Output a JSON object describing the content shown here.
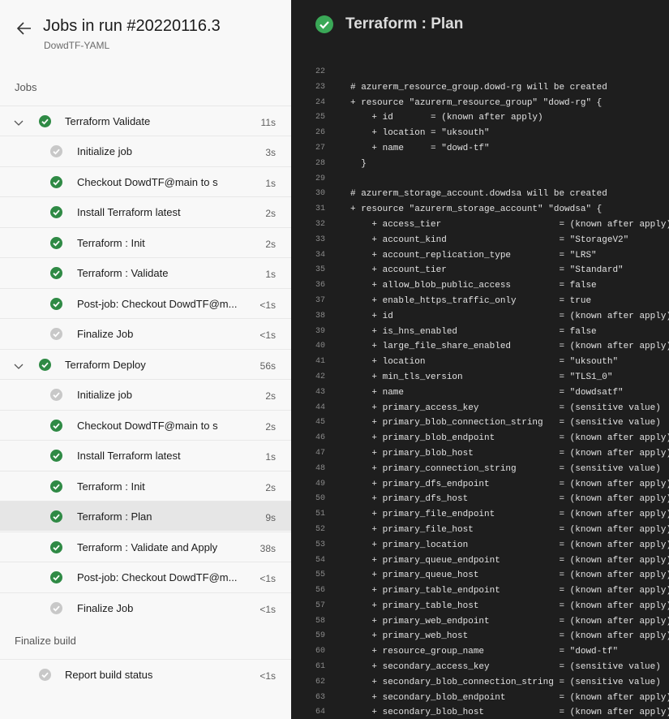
{
  "header": {
    "title": "Jobs in run #20220116.3",
    "subtitle": "DowdTF-YAML"
  },
  "sections": {
    "jobs": "Jobs",
    "finalize": "Finalize build"
  },
  "rows": [
    {
      "kind": "job",
      "status": "succeeded",
      "label": "Terraform Validate",
      "duration": "11s"
    },
    {
      "kind": "step",
      "status": "skipped",
      "label": "Initialize job",
      "duration": "3s"
    },
    {
      "kind": "step",
      "status": "succeeded",
      "label": "Checkout DowdTF@main to s",
      "duration": "1s"
    },
    {
      "kind": "step",
      "status": "succeeded",
      "label": "Install Terraform latest",
      "duration": "2s"
    },
    {
      "kind": "step",
      "status": "succeeded",
      "label": "Terraform : Init",
      "duration": "2s"
    },
    {
      "kind": "step",
      "status": "succeeded",
      "label": "Terraform : Validate",
      "duration": "1s"
    },
    {
      "kind": "step",
      "status": "succeeded",
      "label": "Post-job: Checkout DowdTF@m...",
      "duration": "<1s"
    },
    {
      "kind": "step",
      "status": "skipped",
      "label": "Finalize Job",
      "duration": "<1s"
    },
    {
      "kind": "job",
      "status": "succeeded",
      "label": "Terraform Deploy",
      "duration": "56s"
    },
    {
      "kind": "step",
      "status": "skipped",
      "label": "Initialize job",
      "duration": "2s"
    },
    {
      "kind": "step",
      "status": "succeeded",
      "label": "Checkout DowdTF@main to s",
      "duration": "2s"
    },
    {
      "kind": "step",
      "status": "succeeded",
      "label": "Install Terraform latest",
      "duration": "1s"
    },
    {
      "kind": "step",
      "status": "succeeded",
      "label": "Terraform : Init",
      "duration": "2s"
    },
    {
      "kind": "step",
      "status": "succeeded",
      "label": "Terraform : Plan",
      "duration": "9s",
      "selected": true
    },
    {
      "kind": "step",
      "status": "succeeded",
      "label": "Terraform : Validate and Apply",
      "duration": "38s"
    },
    {
      "kind": "step",
      "status": "succeeded",
      "label": "Post-job: Checkout DowdTF@m...",
      "duration": "<1s"
    },
    {
      "kind": "step",
      "status": "skipped",
      "label": "Finalize Job",
      "duration": "<1s"
    },
    {
      "kind": "final",
      "status": "skipped",
      "label": "Report build status",
      "duration": "<1s"
    }
  ],
  "job_panel": {
    "title": "Terraform : Plan",
    "status": "succeeded"
  },
  "colors": {
    "succeeded": "#2f8a45",
    "skipped": "#c8c8c8",
    "log_bg": "#1e1e1e"
  },
  "log": [
    {
      "n": "22",
      "t": ""
    },
    {
      "n": "23",
      "t": "# azurerm_resource_group.dowd-rg will be created"
    },
    {
      "n": "24",
      "t": "+ resource \"azurerm_resource_group\" \"dowd-rg\" {"
    },
    {
      "n": "25",
      "t": "    + id       = (known after apply)"
    },
    {
      "n": "26",
      "t": "    + location = \"uksouth\""
    },
    {
      "n": "27",
      "t": "    + name     = \"dowd-tf\""
    },
    {
      "n": "28",
      "t": "  }"
    },
    {
      "n": "29",
      "t": ""
    },
    {
      "n": "30",
      "t": "# azurerm_storage_account.dowdsa will be created"
    },
    {
      "n": "31",
      "t": "+ resource \"azurerm_storage_account\" \"dowdsa\" {"
    },
    {
      "n": "32",
      "t": "    + access_tier                      = (known after apply)"
    },
    {
      "n": "33",
      "t": "    + account_kind                     = \"StorageV2\""
    },
    {
      "n": "34",
      "t": "    + account_replication_type         = \"LRS\""
    },
    {
      "n": "35",
      "t": "    + account_tier                     = \"Standard\""
    },
    {
      "n": "36",
      "t": "    + allow_blob_public_access         = false"
    },
    {
      "n": "37",
      "t": "    + enable_https_traffic_only        = true"
    },
    {
      "n": "38",
      "t": "    + id                               = (known after apply)"
    },
    {
      "n": "39",
      "t": "    + is_hns_enabled                   = false"
    },
    {
      "n": "40",
      "t": "    + large_file_share_enabled         = (known after apply)"
    },
    {
      "n": "41",
      "t": "    + location                         = \"uksouth\""
    },
    {
      "n": "42",
      "t": "    + min_tls_version                  = \"TLS1_0\""
    },
    {
      "n": "43",
      "t": "    + name                             = \"dowdsatf\""
    },
    {
      "n": "44",
      "t": "    + primary_access_key               = (sensitive value)"
    },
    {
      "n": "45",
      "t": "    + primary_blob_connection_string   = (sensitive value)"
    },
    {
      "n": "46",
      "t": "    + primary_blob_endpoint            = (known after apply)"
    },
    {
      "n": "47",
      "t": "    + primary_blob_host                = (known after apply)"
    },
    {
      "n": "48",
      "t": "    + primary_connection_string        = (sensitive value)"
    },
    {
      "n": "49",
      "t": "    + primary_dfs_endpoint             = (known after apply)"
    },
    {
      "n": "50",
      "t": "    + primary_dfs_host                 = (known after apply)"
    },
    {
      "n": "51",
      "t": "    + primary_file_endpoint            = (known after apply)"
    },
    {
      "n": "52",
      "t": "    + primary_file_host                = (known after apply)"
    },
    {
      "n": "53",
      "t": "    + primary_location                 = (known after apply)"
    },
    {
      "n": "54",
      "t": "    + primary_queue_endpoint           = (known after apply)"
    },
    {
      "n": "55",
      "t": "    + primary_queue_host               = (known after apply)"
    },
    {
      "n": "56",
      "t": "    + primary_table_endpoint           = (known after apply)"
    },
    {
      "n": "57",
      "t": "    + primary_table_host               = (known after apply)"
    },
    {
      "n": "58",
      "t": "    + primary_web_endpoint             = (known after apply)"
    },
    {
      "n": "59",
      "t": "    + primary_web_host                 = (known after apply)"
    },
    {
      "n": "60",
      "t": "    + resource_group_name              = \"dowd-tf\""
    },
    {
      "n": "61",
      "t": "    + secondary_access_key             = (sensitive value)"
    },
    {
      "n": "62",
      "t": "    + secondary_blob_connection_string = (sensitive value)"
    },
    {
      "n": "63",
      "t": "    + secondary_blob_endpoint          = (known after apply)"
    },
    {
      "n": "64",
      "t": "    + secondary_blob_host              = (known after apply)"
    }
  ]
}
